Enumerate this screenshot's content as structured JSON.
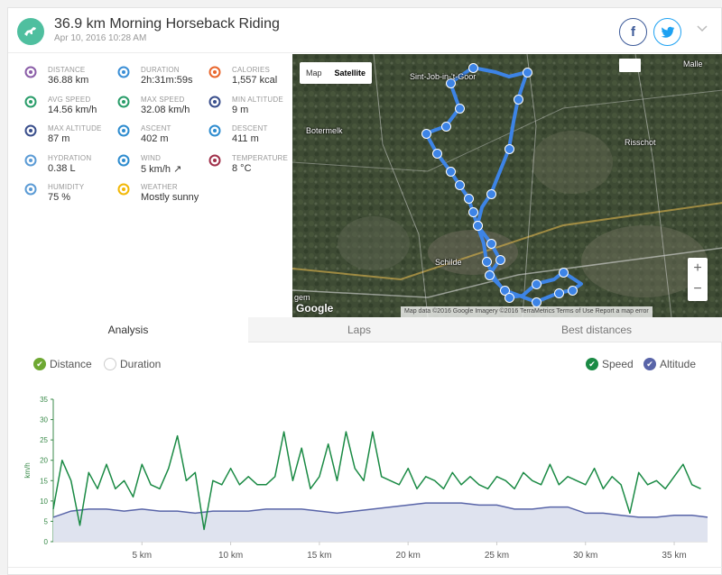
{
  "header": {
    "title": "36.9 km Morning Horseback Riding",
    "subtitle": "Apr 10, 2016 10:28 AM",
    "facebook_label": "f",
    "twitter_label": "t",
    "menu_icon": "chevron-down-icon"
  },
  "stats": [
    {
      "label": "DISTANCE",
      "value": "36.88 km",
      "icon": "distance-icon",
      "color": "#8b5ea8"
    },
    {
      "label": "DURATION",
      "value": "2h:31m:59s",
      "icon": "stopwatch-icon",
      "color": "#3b8fd6"
    },
    {
      "label": "CALORIES",
      "value": "1,557 kcal",
      "icon": "flame-icon",
      "color": "#e9662c"
    },
    {
      "label": "AVG SPEED",
      "value": "14.56 km/h",
      "icon": "speedometer-icon",
      "color": "#2a9d6a"
    },
    {
      "label": "MAX SPEED",
      "value": "32.08 km/h",
      "icon": "speedometer-max-icon",
      "color": "#2a9d6a"
    },
    {
      "label": "MIN ALTITUDE",
      "value": "9 m",
      "icon": "mountain-low-icon",
      "color": "#3a4f8c"
    },
    {
      "label": "MAX ALTITUDE",
      "value": "87 m",
      "icon": "mountain-high-icon",
      "color": "#3a4f8c"
    },
    {
      "label": "ASCENT",
      "value": "402 m",
      "icon": "ascent-icon",
      "color": "#2e8ccf"
    },
    {
      "label": "DESCENT",
      "value": "411 m",
      "icon": "descent-icon",
      "color": "#2e8ccf"
    },
    {
      "label": "HYDRATION",
      "value": "0.38 L",
      "icon": "water-drops-icon",
      "color": "#5b9bd5"
    },
    {
      "label": "WIND",
      "value": "5 km/h ↗",
      "icon": "wind-icon",
      "color": "#2e8ccf"
    },
    {
      "label": "TEMPERATURE",
      "value": "8 °C",
      "icon": "thermometer-icon",
      "color": "#a0304a"
    },
    {
      "label": "HUMIDITY",
      "value": "75 %",
      "icon": "humidity-icon",
      "color": "#5b9bd5"
    },
    {
      "label": "WEATHER",
      "value": "Mostly sunny",
      "icon": "sun-icon",
      "color": "#f2b807"
    }
  ],
  "map": {
    "type_map": "Map",
    "type_satellite": "Satellite",
    "places": [
      "Sint-Job-in-'t-Goor",
      "Botermelk",
      "Risschot",
      "Schilde",
      "Malle",
      "gem"
    ],
    "zoom_in": "+",
    "zoom_out": "−",
    "google": "Google",
    "attribution": "Map data ©2016 Google Imagery ©2016 TerraMetrics    Terms of Use    Report a map error"
  },
  "tabs": [
    "Analysis",
    "Laps",
    "Best distances"
  ],
  "legend": {
    "distance": "Distance",
    "duration": "Duration",
    "speed": "Speed",
    "altitude": "Altitude"
  },
  "colors": {
    "speed": "#1a8a44",
    "altitude": "#5864a8",
    "check_green": "#6ea832",
    "check_speed": "#1a8a44",
    "check_alt": "#5864a8"
  },
  "chart_data": {
    "type": "line",
    "ylabel": "km/h",
    "ylim": [
      0,
      35
    ],
    "yticks": [
      0,
      5,
      10,
      15,
      20,
      25,
      30,
      35
    ],
    "xlim": [
      0,
      36.88
    ],
    "xticks": [
      5,
      10,
      15,
      20,
      25,
      30,
      35
    ],
    "xtick_labels": [
      "5 km",
      "10 km",
      "15 km",
      "20 km",
      "25 km",
      "30 km",
      "35 km"
    ],
    "series": [
      {
        "name": "Speed",
        "x": [
          0,
          0.5,
          1,
          1.5,
          2,
          2.5,
          3,
          3.5,
          4,
          4.5,
          5,
          5.5,
          6,
          6.5,
          7,
          7.5,
          8,
          8.5,
          9,
          9.5,
          10,
          10.5,
          11,
          11.5,
          12,
          12.5,
          13,
          13.5,
          14,
          14.5,
          15,
          15.5,
          16,
          16.5,
          17,
          17.5,
          18,
          18.5,
          19,
          19.5,
          20,
          20.5,
          21,
          21.5,
          22,
          22.5,
          23,
          23.5,
          24,
          24.5,
          25,
          25.5,
          26,
          26.5,
          27,
          27.5,
          28,
          28.5,
          29,
          29.5,
          30,
          30.5,
          31,
          31.5,
          32,
          32.5,
          33,
          33.5,
          34,
          34.5,
          35,
          35.5,
          36,
          36.5
        ],
        "values": [
          8,
          20,
          15,
          4,
          17,
          13,
          19,
          13,
          15,
          11,
          19,
          14,
          13,
          18,
          26,
          15,
          17,
          3,
          15,
          14,
          18,
          14,
          16,
          14,
          14,
          16,
          27,
          15,
          23,
          13,
          16,
          24,
          15,
          27,
          18,
          15,
          27,
          16,
          15,
          14,
          18,
          13,
          16,
          15,
          13,
          17,
          14,
          16,
          14,
          13,
          16,
          15,
          13,
          17,
          15,
          14,
          19,
          14,
          16,
          15,
          14,
          18,
          13,
          16,
          14,
          7,
          17,
          14,
          15,
          13,
          16,
          19,
          14,
          13
        ]
      },
      {
        "name": "Altitude",
        "x": [
          0,
          1,
          2,
          3,
          4,
          5,
          6,
          7,
          8,
          9,
          10,
          11,
          12,
          13,
          14,
          15,
          16,
          17,
          18,
          19,
          20,
          21,
          22,
          23,
          24,
          25,
          26,
          27,
          28,
          29,
          30,
          31,
          32,
          33,
          34,
          35,
          36,
          36.88
        ],
        "values": [
          6,
          7.5,
          8,
          8,
          7.5,
          8,
          7.5,
          7.5,
          7,
          7.5,
          7.5,
          7.5,
          8,
          8,
          8,
          7.5,
          7,
          7.5,
          8,
          8.5,
          9,
          9.5,
          9.5,
          9.5,
          9,
          9,
          8,
          8,
          8.5,
          8.5,
          7,
          7,
          6.5,
          6,
          6,
          6.5,
          6.5,
          6
        ]
      }
    ]
  }
}
